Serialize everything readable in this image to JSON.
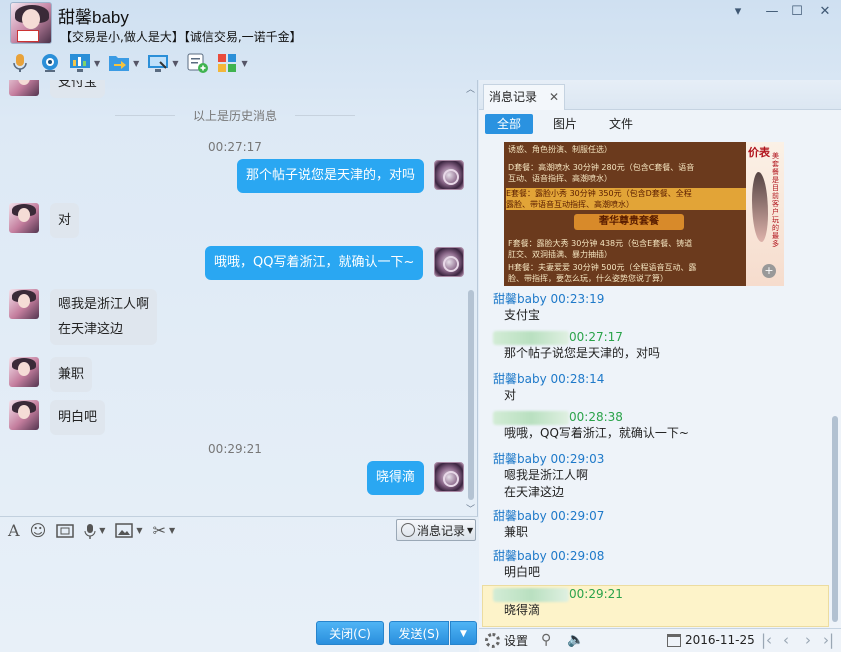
{
  "window": {
    "contact_name": "甜馨baby",
    "signature": "【交易是小,做人是大】【诚信交易,一诺千金】",
    "buttons": {
      "dropdown": "▾",
      "minimize": "—",
      "maximize": "☐",
      "close": "✕"
    }
  },
  "toolbar": [
    {
      "name": "voice-call-icon"
    },
    {
      "name": "video-call-icon"
    },
    {
      "name": "remote-assist-icon",
      "dropdown": true
    },
    {
      "name": "send-file-icon",
      "dropdown": true
    },
    {
      "name": "screen-share-icon",
      "dropdown": true
    },
    {
      "name": "create-group-icon"
    },
    {
      "name": "apps-icon",
      "dropdown": true
    }
  ],
  "chat": {
    "history_partial": "支付宝",
    "history_separator": "以上是历史消息",
    "timestamps": [
      "00:27:17",
      "00:29:21"
    ],
    "messages": {
      "m1": "那个帖子说您是天津的，对吗",
      "m2": "对",
      "m3": "哦哦，QQ写着浙江，就确认一下~",
      "m4a": "嗯我是浙江人啊",
      "m4b": "在天津这边",
      "m5": "兼职",
      "m6": "明白吧",
      "m7": "晓得滴"
    }
  },
  "input": {
    "history_button": "消息记录",
    "close_button": "关闭(C)",
    "send_button": "发送(S)"
  },
  "history_panel": {
    "tab_label": "消息记录",
    "filters": [
      "全部",
      "图片",
      "文件"
    ],
    "image_rows": [
      "         诱惑、角色扮演、制服任选）",
      "D套餐：高潮喷水 30分钟  280元（包含C套餐、语音",
      "       互动、语音指挥、高潮喷水）",
      "E套餐：露脸小秀 30分钟  350元（包含D套餐、全程",
      "       露脸、带语音互动指挥、高潮喷水）",
      "F套餐：露脸大秀 30分钟  438元（包含E套餐、铸道",
      "       肛交、双洞插满、暴力抽插）",
      "H套餐：夫妻爱爱 30分钟  500元（全程语音互动、露",
      "       脸、带指挥，要怎么玩，什么姿势您说了算）"
    ],
    "image_banner": "奢华尊贵套餐",
    "image_side_title": "价表",
    "image_side_vertical": "美套餐是目前客户玩的最多",
    "records": [
      {
        "head": "甜馨baby 00:23:19",
        "me": false,
        "lines": [
          "支付宝"
        ]
      },
      {
        "head": "00:27:17",
        "me": true,
        "lines": [
          "那个帖子说您是天津的，对吗"
        ]
      },
      {
        "head": "甜馨baby 00:28:14",
        "me": false,
        "lines": [
          "对"
        ]
      },
      {
        "head": "00:28:38",
        "me": true,
        "lines": [
          "哦哦，QQ写着浙江，就确认一下~"
        ]
      },
      {
        "head": "甜馨baby 00:29:03",
        "me": false,
        "lines": [
          "嗯我是浙江人啊",
          "在天津这边"
        ]
      },
      {
        "head": "甜馨baby 00:29:07",
        "me": false,
        "lines": [
          "兼职"
        ]
      },
      {
        "head": "甜馨baby 00:29:08",
        "me": false,
        "lines": [
          "明白吧"
        ]
      },
      {
        "head": "00:29:21",
        "me": true,
        "lines": [
          "晓得滴"
        ]
      }
    ],
    "footer": {
      "settings": "设置",
      "date": "2016-11-25"
    }
  }
}
